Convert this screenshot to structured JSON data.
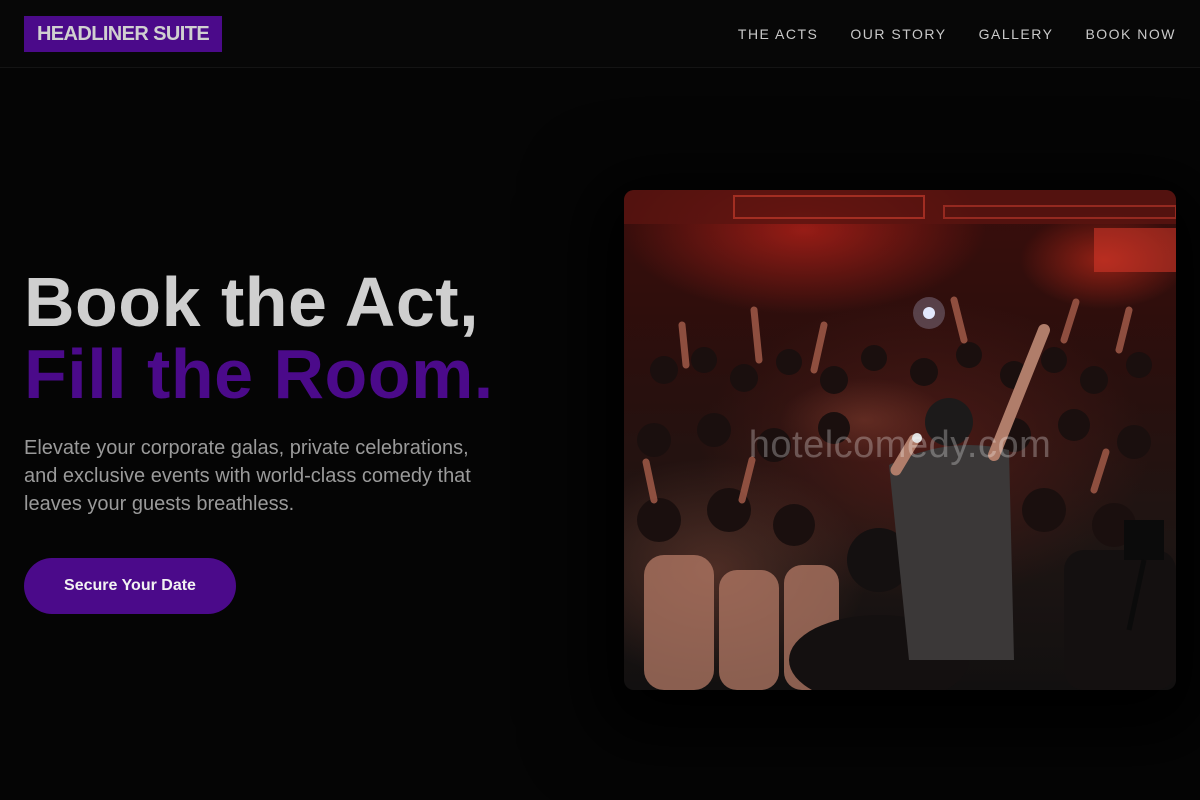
{
  "header": {
    "logo_text": "HEADLINER SUITE",
    "nav": [
      {
        "label": "THE ACTS"
      },
      {
        "label": "OUR STORY"
      },
      {
        "label": "GALLERY"
      },
      {
        "label": "BOOK NOW"
      }
    ]
  },
  "hero": {
    "headline_line1": "Book the Act,",
    "headline_line2": "Fill the Room.",
    "subtext": "Elevate your corporate galas, private celebrations, and exclusive events with world-class comedy that leaves your guests breathless.",
    "cta_label": "Secure Your Date",
    "image": {
      "subject": "performer on stage with microphone facing a crowd with raised hands",
      "watermark": "hotelcomedy.com"
    }
  },
  "colors": {
    "background": "#050505",
    "accent": "#4b0a8a",
    "headline_primary": "#cfcfcf",
    "body_text": "#9a9a9a"
  }
}
